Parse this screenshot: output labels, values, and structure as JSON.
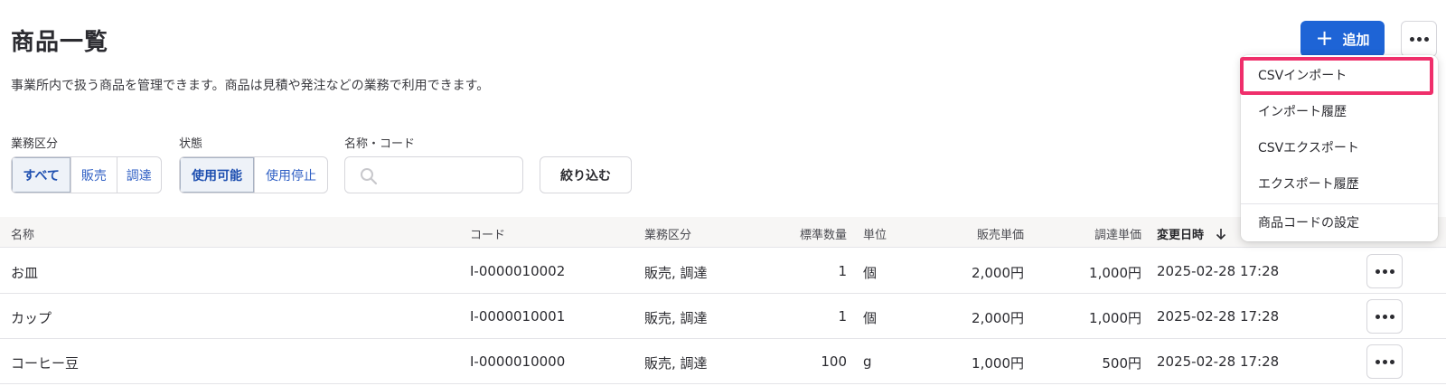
{
  "page": {
    "title": "商品一覧",
    "description": "事業所内で扱う商品を管理できます。商品は見積や発注などの業務で利用できます。"
  },
  "header": {
    "add_label": "追加",
    "more_icon": "more-horizontal-icon"
  },
  "menu": {
    "items": [
      {
        "label": "CSVインポート",
        "highlighted": true
      },
      {
        "label": "インポート履歴"
      },
      {
        "label": "CSVエクスポート"
      },
      {
        "label": "エクスポート履歴"
      },
      {
        "label": "商品コードの設定"
      }
    ],
    "highlight_color": "#ef2f6b"
  },
  "filters": {
    "business_type": {
      "label": "業務区分",
      "options": [
        "すべて",
        "販売",
        "調達"
      ],
      "selected": "すべて"
    },
    "status": {
      "label": "状態",
      "options": [
        "使用可能",
        "使用停止"
      ],
      "selected": "使用可能"
    },
    "search": {
      "label": "名称・コード",
      "value": "",
      "placeholder": ""
    },
    "apply_label": "絞り込む"
  },
  "table": {
    "columns": [
      "名称",
      "コード",
      "業務区分",
      "標準数量",
      "単位",
      "販売単価",
      "調達単価",
      "変更日時"
    ],
    "sort_column": "変更日時",
    "sort_direction": "desc",
    "rows": [
      {
        "name": "お皿",
        "code": "I-0000010002",
        "type": "販売, 調達",
        "qty": "1",
        "unit": "個",
        "sale": "2,000円",
        "purchase": "1,000円",
        "updated": "2025-02-28 17:28"
      },
      {
        "name": "カップ",
        "code": "I-0000010001",
        "type": "販売, 調達",
        "qty": "1",
        "unit": "個",
        "sale": "2,000円",
        "purchase": "1,000円",
        "updated": "2025-02-28 17:28"
      },
      {
        "name": "コーヒー豆",
        "code": "I-0000010000",
        "type": "販売, 調達",
        "qty": "100",
        "unit": "g",
        "sale": "1,000円",
        "purchase": "500円",
        "updated": "2025-02-28 17:28"
      }
    ]
  },
  "colors": {
    "primary": "#1e64d6",
    "link": "#2f5fc4"
  }
}
